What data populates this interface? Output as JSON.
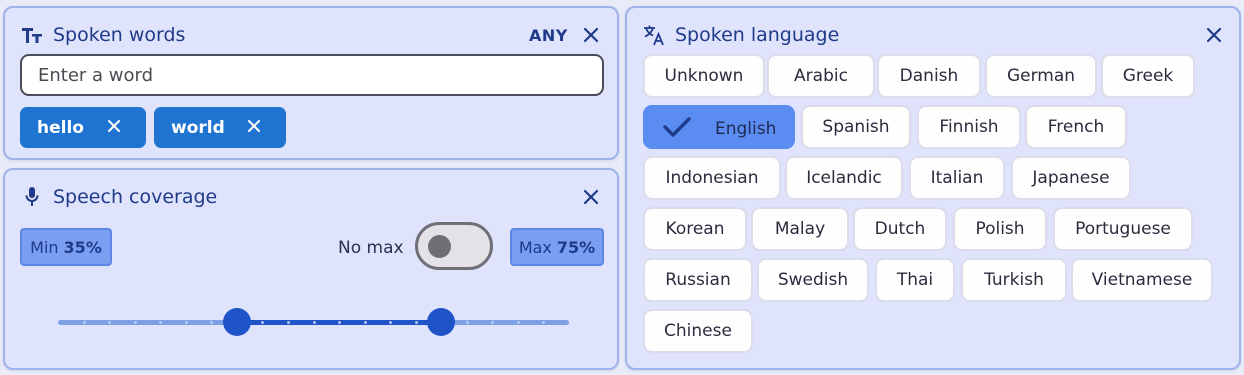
{
  "spoken_words": {
    "title": "Spoken words",
    "icon": "text-size-icon",
    "mode_label": "ANY",
    "input_placeholder": "Enter a word",
    "input_value": "",
    "chips": [
      "hello",
      "world"
    ]
  },
  "speech_coverage": {
    "title": "Speech coverage",
    "icon": "microphone-icon",
    "min_prefix": "Min",
    "min_value": "35%",
    "no_max_label": "No max",
    "no_max_enabled": false,
    "max_prefix": "Max",
    "max_value": "75%",
    "slider_min": 0.35,
    "slider_max": 0.75
  },
  "spoken_language": {
    "title": "Spoken language",
    "icon": "translate-icon",
    "languages": [
      "Unknown",
      "Arabic",
      "Danish",
      "German",
      "Greek",
      "English",
      "Spanish",
      "Finnish",
      "French",
      "Indonesian",
      "Icelandic",
      "Italian",
      "Japanese",
      "Korean",
      "Malay",
      "Dutch",
      "Polish",
      "Portuguese",
      "Russian",
      "Swedish",
      "Thai",
      "Turkish",
      "Vietnamese",
      "Chinese"
    ],
    "selected": "English"
  },
  "colors": {
    "accent": "#1f74d2",
    "selected_chip": "#5b8cf2",
    "panel_bg": "#dfe3fb",
    "title_text": "#1f3b8a"
  }
}
